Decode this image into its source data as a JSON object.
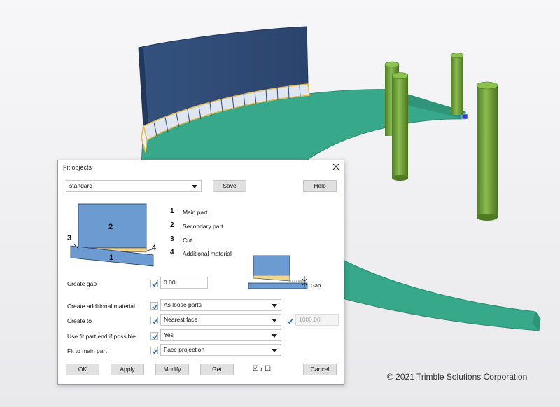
{
  "dialog": {
    "title": "Fit objects",
    "settings": {
      "selected": "standard"
    },
    "buttons": {
      "save": "Save",
      "help": "Help",
      "ok": "OK",
      "apply": "Apply",
      "modify": "Modify",
      "get": "Get",
      "cancel": "Cancel",
      "toggle": "☑ / ☐"
    },
    "legend": [
      {
        "num": "1",
        "label": "Main part"
      },
      {
        "num": "2",
        "label": "Secondary part"
      },
      {
        "num": "3",
        "label": "Cut"
      },
      {
        "num": "4",
        "label": "Additional material"
      }
    ],
    "diagram_numbers": {
      "n1": "1",
      "n2": "2",
      "n3": "3",
      "n4": "4"
    },
    "gap_label": "Gap",
    "fields": {
      "create_gap": {
        "label": "Create gap",
        "checked": true,
        "value": "0.00"
      },
      "additional_material": {
        "label": "Create additional material",
        "checked": true,
        "value": "As loose parts"
      },
      "create_to": {
        "label": "Create to",
        "checked": true,
        "value": "Nearest face",
        "extra_checked": true,
        "extra_value": "1000.00"
      },
      "use_fit_end": {
        "label": "Use fit part end if possible",
        "checked": true,
        "value": "Yes"
      },
      "fit_to_main": {
        "label": "Fit to main part",
        "checked": true,
        "value": "Face projection"
      }
    }
  },
  "copyright": "© 2021 Trimble Solutions Corporation",
  "colors": {
    "accent": "#2a6fb0",
    "plate": "#37a88a",
    "panel": "#2e4a78",
    "column": "#6ea03a",
    "diagram_blue": "#6b9bd1",
    "additional_material": "#f3d58a"
  }
}
